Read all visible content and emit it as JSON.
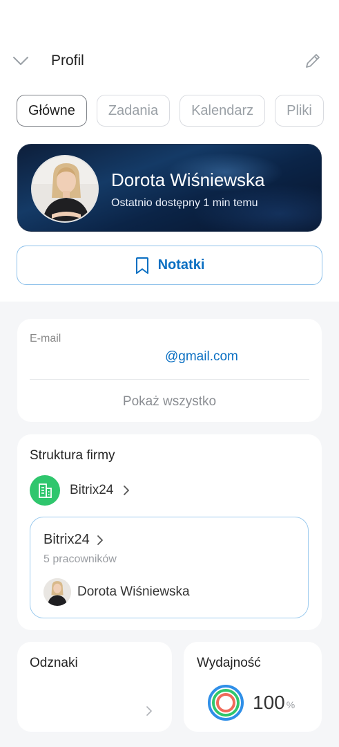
{
  "header": {
    "title": "Profil"
  },
  "tabs": [
    {
      "label": "Główne",
      "active": true
    },
    {
      "label": "Zadania",
      "active": false
    },
    {
      "label": "Kalendarz",
      "active": false
    },
    {
      "label": "Pliki",
      "active": false
    }
  ],
  "profile": {
    "name": "Dorota Wiśniewska",
    "status": "Ostatnio dostępny 1 min temu"
  },
  "notes_button": {
    "label": "Notatki",
    "icon": "bookmark-icon"
  },
  "contact": {
    "email_caption": "E-mail",
    "email_value": "@gmail.com",
    "show_all": "Pokaż wszystko"
  },
  "structure": {
    "title": "Struktura firmy",
    "company": "Bitrix24",
    "department": {
      "name": "Bitrix24",
      "count": "5 pracowników",
      "employee": "Dorota Wiśniewska"
    }
  },
  "badges": {
    "title": "Odznaki"
  },
  "performance": {
    "title": "Wydajność",
    "value": "100",
    "unit": "%"
  },
  "colors": {
    "accent": "#0a6fc2",
    "company_icon_bg": "#2fc66d",
    "ring_outer": "#2f8fe8",
    "ring_middle": "#2fc66d",
    "ring_inner": "#f06a5a"
  }
}
